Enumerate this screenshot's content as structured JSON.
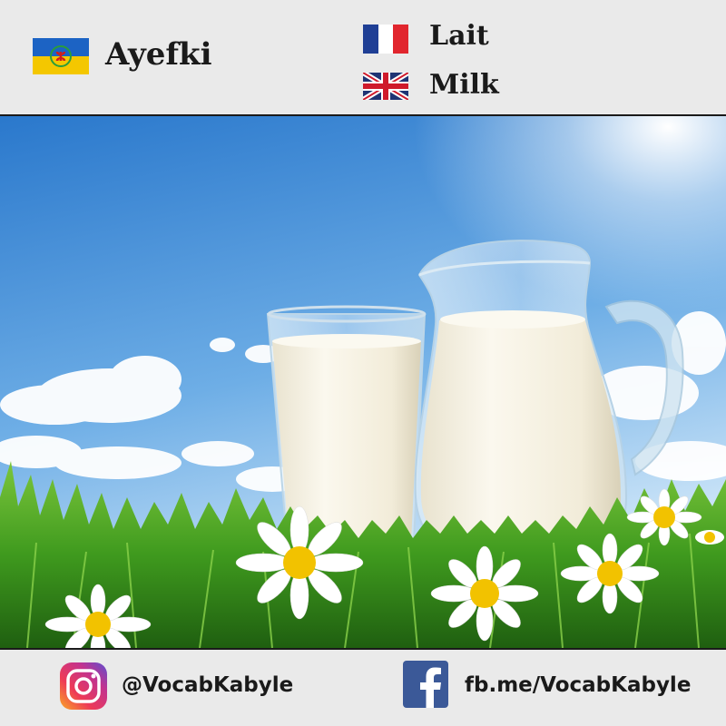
{
  "header": {
    "kabyle_word": "Ayefki",
    "french_word": "Lait",
    "english_word": "Milk",
    "kabyle_flag_icon": "kabyle-flag-icon",
    "french_flag_icon": "french-flag-icon",
    "uk_flag_icon": "uk-flag-icon"
  },
  "footer": {
    "instagram_handle": "@VocabKabyle",
    "facebook_link": "fb.me/VocabKabyle",
    "instagram_icon": "instagram-icon",
    "facebook_icon": "facebook-icon"
  },
  "colors": {
    "background": "#eaeaea",
    "sky_top": "#2f7fd0",
    "sky_bottom": "#cfe6f8",
    "grass": "#3f9a1e",
    "milk": "#f5f1e4",
    "facebook_blue": "#3b5998",
    "daisy_center": "#f2c200"
  },
  "scene": {
    "image_subject": "milk-glass-and-jug-in-grass"
  }
}
